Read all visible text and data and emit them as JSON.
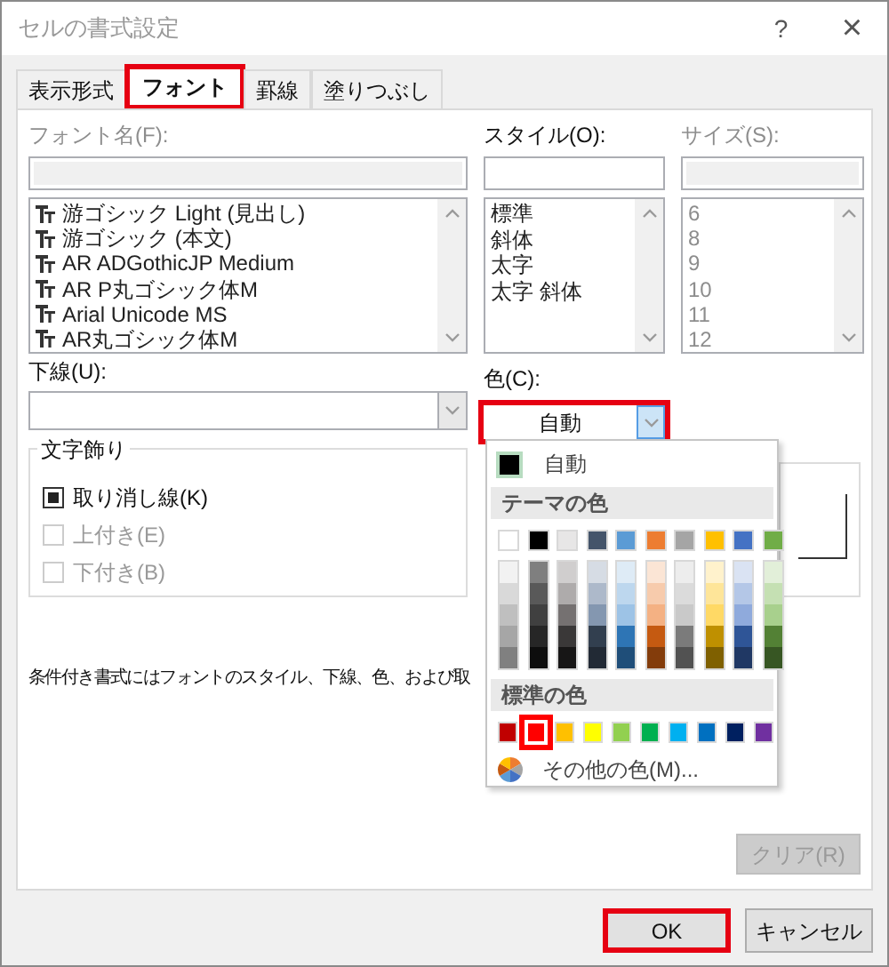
{
  "window": {
    "title": "セルの書式設定",
    "help": "?",
    "close": "×"
  },
  "tabs": [
    {
      "label": "表示形式",
      "selected": false
    },
    {
      "label": "フォント",
      "selected": true
    },
    {
      "label": "罫線",
      "selected": false
    },
    {
      "label": "塗りつぶし",
      "selected": false
    }
  ],
  "font_name": {
    "label": "フォント名(F):",
    "disabled": true,
    "items": [
      "游ゴシック Light (見出し)",
      "游ゴシック (本文)",
      "AR ADGothicJP Medium",
      "AR P丸ゴシック体M",
      "Arial Unicode MS",
      "AR丸ゴシック体M"
    ]
  },
  "style": {
    "label": "スタイル(O):",
    "disabled": false,
    "items": [
      "標準",
      "斜体",
      "太字",
      "太字 斜体"
    ]
  },
  "size": {
    "label": "サイズ(S):",
    "disabled": true,
    "items": [
      "6",
      "8",
      "9",
      "10",
      "11",
      "12"
    ]
  },
  "underline": {
    "label": "下線(U):"
  },
  "color": {
    "label": "色(C):",
    "value": "自動",
    "highlighted": true
  },
  "effects": {
    "title": "文字飾り",
    "checkboxes": [
      {
        "label": "取り消し線(K)",
        "checked": true,
        "disabled": false
      },
      {
        "label": "上付き(E)",
        "checked": false,
        "disabled": true
      },
      {
        "label": "下付き(B)",
        "checked": false,
        "disabled": true
      }
    ]
  },
  "note": "条件付き書式にはフォントのスタイル、下線、色、および取",
  "clear_button": {
    "label": "クリア(R)",
    "disabled": true
  },
  "buttons": [
    {
      "label": "OK",
      "highlighted": true
    },
    {
      "label": "キャンセル",
      "highlighted": false
    }
  ],
  "color_menu": {
    "automatic": {
      "label": "自動",
      "color": "#000000"
    },
    "theme_header": "テーマの色",
    "theme_columns": [
      {
        "color": "#ffffff",
        "shades": [
          {
            "color": "#f2f2f2"
          },
          {
            "color": "#d9d9d9"
          },
          {
            "color": "#bfbfbf"
          },
          {
            "color": "#a6a6a6"
          },
          {
            "color": "#808080"
          }
        ]
      },
      {
        "color": "#000000",
        "shades": [
          {
            "color": "#7f7f7f"
          },
          {
            "color": "#595959"
          },
          {
            "color": "#404040"
          },
          {
            "color": "#262626"
          },
          {
            "color": "#0d0d0d"
          }
        ]
      },
      {
        "color": "#e7e6e6",
        "shades": [
          {
            "color": "#d0cece"
          },
          {
            "color": "#aeabab"
          },
          {
            "color": "#757171"
          },
          {
            "color": "#3a3838"
          },
          {
            "color": "#171616"
          }
        ]
      },
      {
        "color": "#44546a",
        "shades": [
          {
            "color": "#d6dce4"
          },
          {
            "color": "#adb9ca"
          },
          {
            "color": "#8497b0"
          },
          {
            "color": "#323f4f"
          },
          {
            "color": "#222a35"
          }
        ]
      },
      {
        "color": "#5b9bd5",
        "shades": [
          {
            "color": "#deebf6"
          },
          {
            "color": "#bdd7ee"
          },
          {
            "color": "#9dc3e6"
          },
          {
            "color": "#2e75b5"
          },
          {
            "color": "#1f4e79"
          }
        ]
      },
      {
        "color": "#ed7d31",
        "shades": [
          {
            "color": "#fbe5d5"
          },
          {
            "color": "#f7cbac"
          },
          {
            "color": "#f4b183"
          },
          {
            "color": "#c55a11"
          },
          {
            "color": "#833c0b"
          }
        ]
      },
      {
        "color": "#a5a5a5",
        "shades": [
          {
            "color": "#ededed"
          },
          {
            "color": "#dbdbdb"
          },
          {
            "color": "#c9c9c9"
          },
          {
            "color": "#7b7b7b"
          },
          {
            "color": "#525252"
          }
        ]
      },
      {
        "color": "#ffc000",
        "shades": [
          {
            "color": "#fff2cc"
          },
          {
            "color": "#fee599"
          },
          {
            "color": "#ffd965"
          },
          {
            "color": "#bf9000"
          },
          {
            "color": "#7f6000"
          }
        ]
      },
      {
        "color": "#4472c4",
        "shades": [
          {
            "color": "#dae3f3"
          },
          {
            "color": "#b4c7e7"
          },
          {
            "color": "#8faadc"
          },
          {
            "color": "#2f5597"
          },
          {
            "color": "#203864"
          }
        ]
      },
      {
        "color": "#70ad47",
        "shades": [
          {
            "color": "#e2efd9"
          },
          {
            "color": "#c5e0b3"
          },
          {
            "color": "#a8d08d"
          },
          {
            "color": "#538135"
          },
          {
            "color": "#375623"
          }
        ]
      }
    ],
    "standard_header": "標準の色",
    "standard_colors": [
      {
        "color": "#c00000",
        "selected": false
      },
      {
        "color": "#ff0000",
        "selected": true
      },
      {
        "color": "#ffc000",
        "selected": false
      },
      {
        "color": "#ffff00",
        "selected": false
      },
      {
        "color": "#92d050",
        "selected": false
      },
      {
        "color": "#00b050",
        "selected": false
      },
      {
        "color": "#00b0f0",
        "selected": false
      },
      {
        "color": "#0070c0",
        "selected": false
      },
      {
        "color": "#002060",
        "selected": false
      },
      {
        "color": "#7030a0",
        "selected": false
      }
    ],
    "more_colors": "その他の色(M)..."
  }
}
